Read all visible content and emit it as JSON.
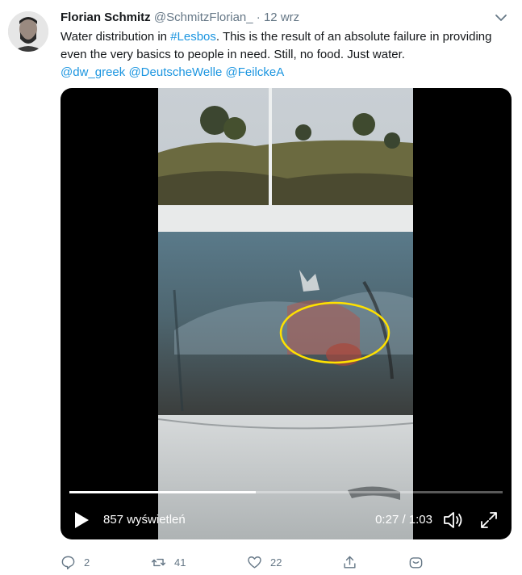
{
  "tweet": {
    "author_name": "Florian Schmitz",
    "author_handle": "@SchmitzFlorian_",
    "separator": "·",
    "date": "12 wrz",
    "text_part1": "Water distribution in ",
    "hashtag": "#Lesbos",
    "text_part2": ". This is the result of an absolute failure in providing even the very basics to people in need. Still, no food. Just water.",
    "mention1": "@dw_greek",
    "mention2": "@DeutscheWelle",
    "mention3": "@FeilckeA"
  },
  "video": {
    "views": "857 wyświetleń",
    "time": "0:27 / 1:03",
    "progress_fraction": 0.43
  },
  "actions": {
    "reply_count": "2",
    "retweet_count": "41",
    "like_count": "22"
  },
  "colors": {
    "link": "#1b95e0",
    "muted": "#657786",
    "annotation_circle": "#ffe100"
  }
}
